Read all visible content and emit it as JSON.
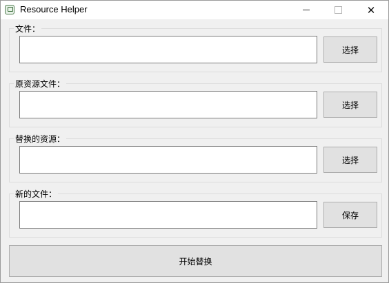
{
  "window": {
    "title": "Resource Helper"
  },
  "groups": [
    {
      "label": "文件：",
      "value": "",
      "button": "选择"
    },
    {
      "label": "原资源文件：",
      "value": "",
      "button": "选择"
    },
    {
      "label": "替换的资源：",
      "value": "",
      "button": "选择"
    },
    {
      "label": "新的文件：",
      "value": "",
      "button": "保存"
    }
  ],
  "actions": {
    "start_label": "开始替换"
  },
  "icons": {
    "minimize": "minimize-icon",
    "maximize": "maximize-icon",
    "close": "close-icon"
  }
}
